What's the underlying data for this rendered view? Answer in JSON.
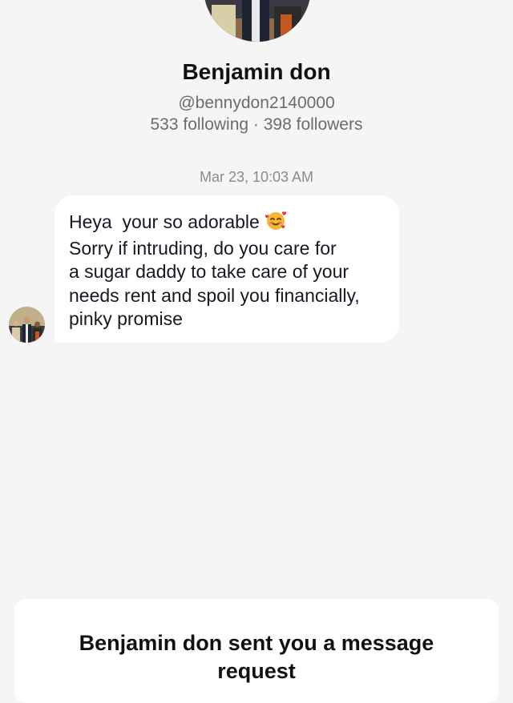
{
  "profile": {
    "avatar_icon": "profile-photo",
    "name": "Benjamin don",
    "handle": "@bennydon2140000",
    "stats": "533 following · 398 followers"
  },
  "conversation": {
    "timestamp": "Mar 23, 10:03 AM",
    "message": {
      "lines": [
        "Heya  your so adorable",
        "Sorry if intruding, do you care for",
        "a sugar daddy to take care of your",
        "needs rent and spoil you financially,",
        "pinky promise"
      ],
      "emoji": "smiling-face-with-hearts-emoji"
    },
    "sender_avatar_icon": "sender-avatar-photo"
  },
  "request_banner": {
    "title": "Benjamin don sent you a message request"
  }
}
